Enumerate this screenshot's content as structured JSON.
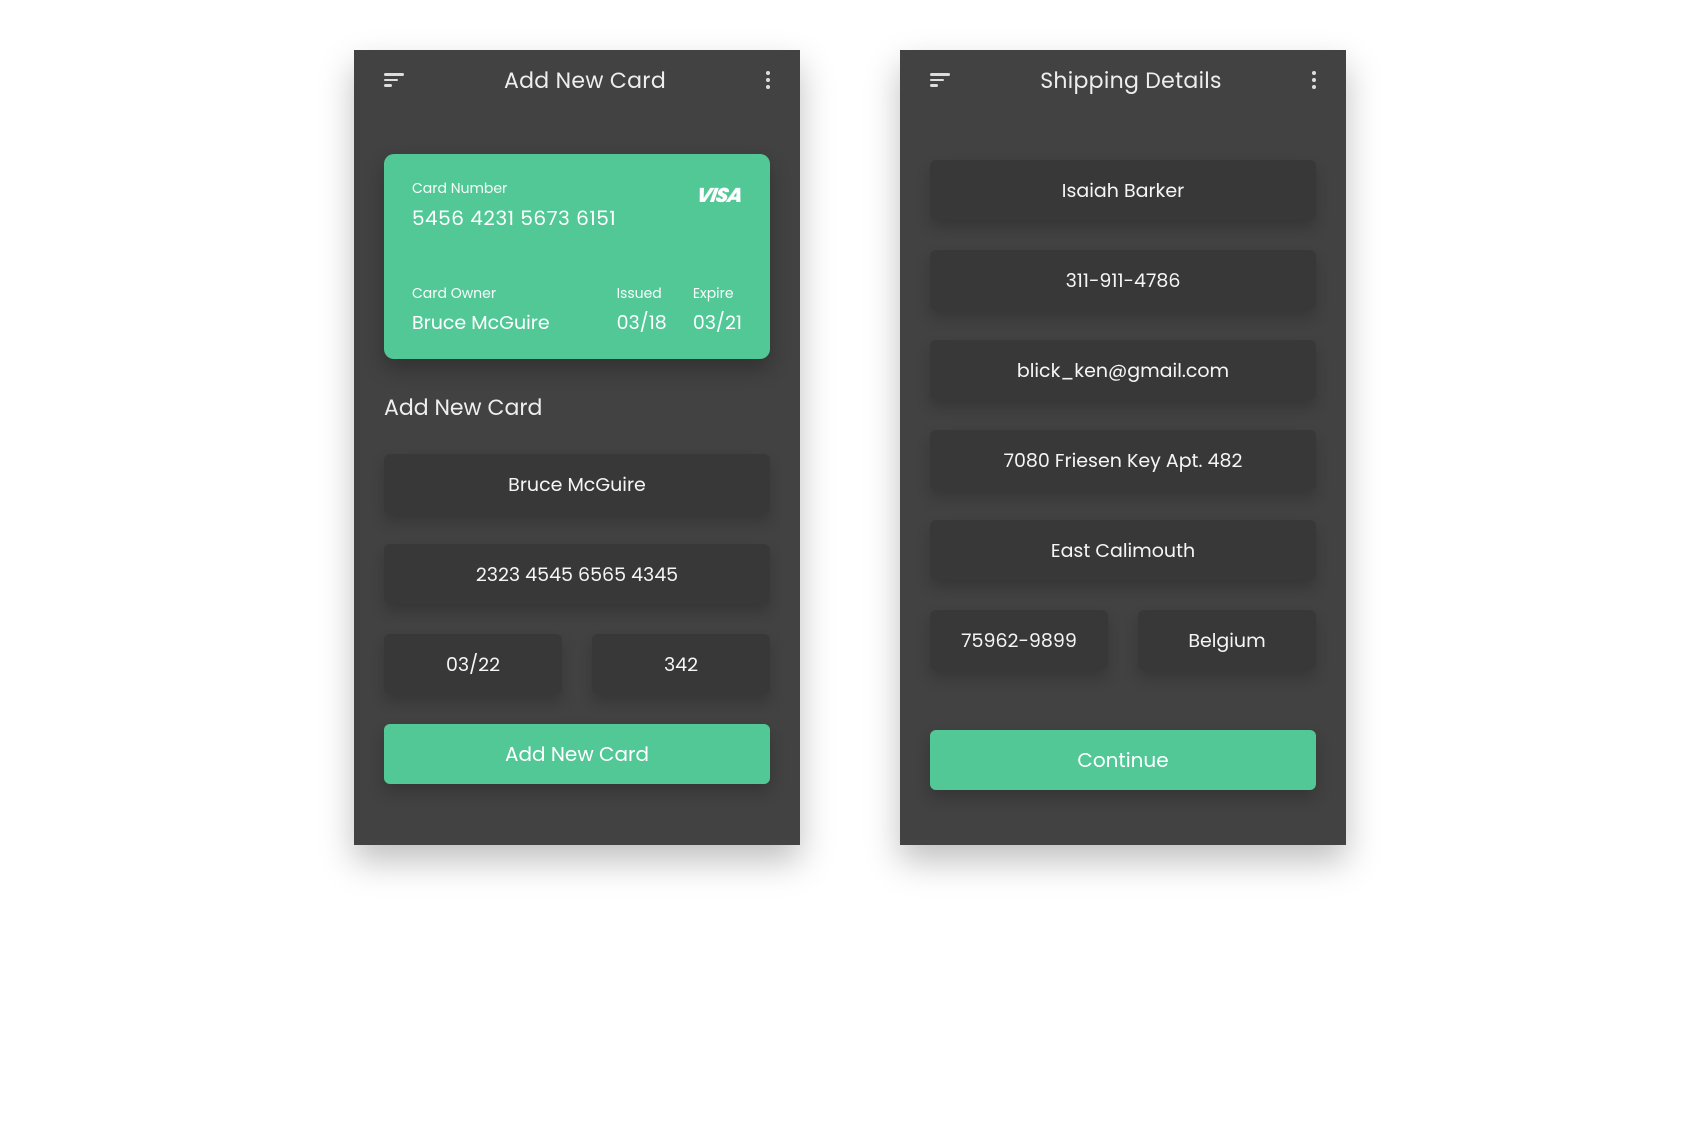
{
  "colors": {
    "accent": "#52C897",
    "panel": "#424242",
    "field": "#383838"
  },
  "screens": {
    "addCard": {
      "title": "Add New Card",
      "card": {
        "numberLabel": "Card Number",
        "number": "5456 4231 5673 6151",
        "ownerLabel": "Card Owner",
        "owner": "Bruce McGuire",
        "issuedLabel": "Issued",
        "issued": "03/18",
        "expireLabel": "Expire",
        "expire": "03/21",
        "brand": "VISA"
      },
      "sectionTitle": "Add New Card",
      "fields": {
        "owner": "Bruce McGuire",
        "number": "2323 4545 6565 4345",
        "expiry": "03/22",
        "cvv": "342"
      },
      "submit": "Add New Card"
    },
    "shipping": {
      "title": "Shipping Details",
      "fields": {
        "name": "Isaiah Barker",
        "phone": "311-911-4786",
        "email": "blick_ken@gmail.com",
        "address": "7080 Friesen Key Apt. 482",
        "city": "East Calimouth",
        "zip": "75962-9899",
        "country": "Belgium"
      },
      "submit": "Continue"
    }
  }
}
